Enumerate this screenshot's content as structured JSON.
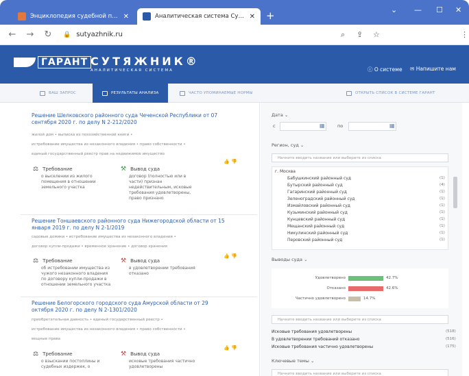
{
  "browser": {
    "tabs": [
      {
        "title": "Энциклопедия судебной практ",
        "active": false,
        "favicon_color": "#e07840"
      },
      {
        "title": "Аналитическая система Сутяж",
        "active": true,
        "favicon_color": "#2a5aa8"
      }
    ],
    "new_tab": "+",
    "url": "sutyazhnik.ru"
  },
  "header": {
    "logo_text": "ГАРАНТ",
    "brand_name": "СУТЯЖНИК®",
    "brand_subtitle": "АНАЛИТИЧЕСКАЯ СИСТЕМА",
    "about": "О системе",
    "contact": "Напишите нам"
  },
  "toolbar": {
    "query": "ВАШ ЗАПРОС",
    "results": "РЕЗУЛЬТАТЫ АНАЛИЗА",
    "norms": "ЧАСТО УПОМИНАЕМЫЕ НОРМЫ",
    "open_list": "ОТКРЫТЬ СПИСОК В СИСТЕМЕ ГАРАНТ"
  },
  "results": [
    {
      "title": "Решение Шелковского районного суда Чеченской Республики от 07 сентября 2020 г. по делу N 2-212/2020",
      "tag_lines": [
        "жилой дом  •  выписка из похозяйственной книги  •",
        "истребование имущества из незаконного владения  •  право собственности  •",
        "единый государственный реестр прав на недвижимое имущество"
      ],
      "requirement_label": "Требование",
      "requirement_text": [
        "о выселении из жилого",
        "помещения в отношении",
        "земельного участка"
      ],
      "conclusion_label": "Вывод суда",
      "conclusion_text": [
        "договор (полностью или в",
        "части) признан",
        "недействительным, исковые",
        "требования удовлетворены,",
        "право признано"
      ]
    },
    {
      "title": "Решение Тоншаевского районного суда Нижегородской области от 15 января 2019 г. по делу N 2-1/2019",
      "tag_lines": [
        "садовые домики  •  истребование имущества из незаконного владения  •",
        "договор купли-продажи  •  временное хранение  •  договор хранения"
      ],
      "requirement_label": "Требование",
      "requirement_text": [
        "об истребовании имущества из",
        "чужого незаконного владения",
        "по договору купли-продажи в",
        "отношении земельного участка"
      ],
      "conclusion_label": "Вывод суда",
      "conclusion_text": [
        "в удовлетворении требования",
        "отказано"
      ]
    },
    {
      "title": "Решение Белогорского городского суда Амурской области от 29 октября 2020 г. по делу N 2-1301/2020",
      "tag_lines": [
        "приобретательная давность  •  единый государственный реестр  •",
        "истребование имущества из незаконного владения  •  право собственности  •",
        "вещные права"
      ],
      "requirement_label": "Требование",
      "requirement_text": [
        "о взыскании постоплины и",
        "судебных издержек, о"
      ],
      "conclusion_label": "Вывод суда",
      "conclusion_text": [
        "исковые требования частично",
        "удовлетворены"
      ]
    }
  ],
  "filters": {
    "date_label": "Дата",
    "date_from": "с",
    "date_to": "по",
    "region_label": "Регион, суд",
    "region_placeholder": "Начните вводить название или выберите из списка",
    "region_group": "г. Москва",
    "courts": [
      {
        "name": "Бабушкинский районный суд",
        "count": "(1)"
      },
      {
        "name": "Бутырский районный суд",
        "count": "(4)"
      },
      {
        "name": "Гагаринский районный суд",
        "count": "(1)"
      },
      {
        "name": "Зеленоградский районный суд",
        "count": "(1)"
      },
      {
        "name": "Измайловский районный суд",
        "count": "(1)"
      },
      {
        "name": "Кузьминский районный суд",
        "count": "(1)"
      },
      {
        "name": "Кунцевский районный суд",
        "count": "(1)"
      },
      {
        "name": "Мещанский районный суд",
        "count": "(1)"
      },
      {
        "name": "Никулинский районный суд",
        "count": "(1)"
      },
      {
        "name": "Перовский районный суд",
        "count": "(1)"
      }
    ],
    "outcome_label": "Выводы суда",
    "outcome_placeholder": "Начните вводить название или выберите из списка",
    "outcomes": [
      {
        "name": "Исковые требования удовлетворены",
        "count": "(518)"
      },
      {
        "name": "В удовлетворении требований отказано",
        "count": "(516)"
      },
      {
        "name": "Исковые требования частично удовлетворены",
        "count": "(175)"
      }
    ],
    "keywords_label": "Ключевые темы",
    "keywords_placeholder": "Начните вводить название или выберите из списка"
  },
  "chart_data": {
    "type": "bar",
    "categories": [
      "Удовлетворено",
      "Отказано",
      "Частично удовлетворено"
    ],
    "values": [
      42.7,
      42.6,
      14.7
    ],
    "value_labels": [
      "42.7%",
      "42.6%",
      "14.7%"
    ],
    "colors": [
      "#6cc07a",
      "#e86a6a",
      "#c9bfa8"
    ],
    "xlim": [
      0,
      100
    ]
  }
}
